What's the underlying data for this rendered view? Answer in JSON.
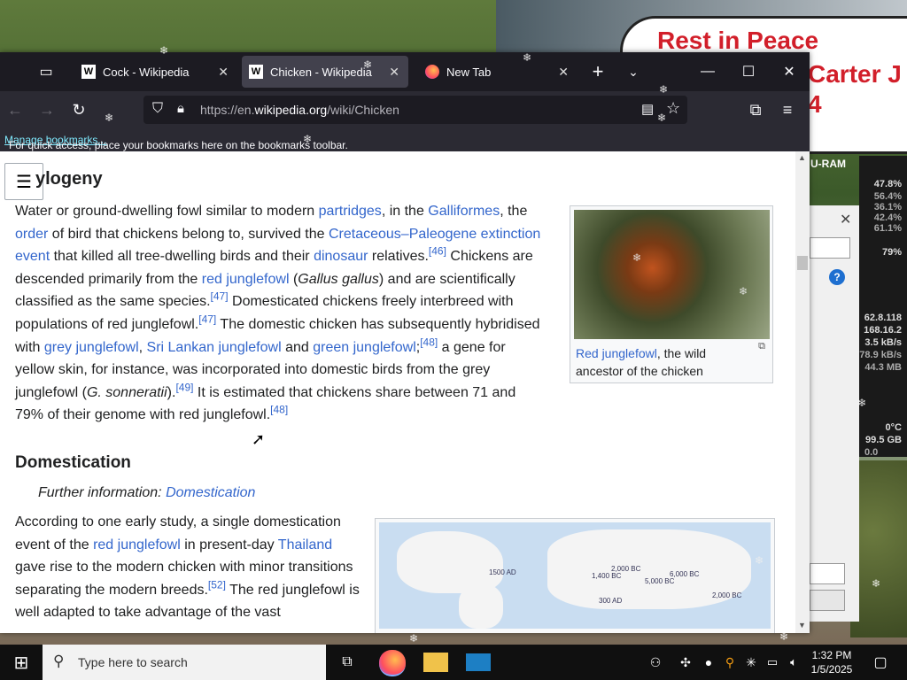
{
  "desktop": {
    "banner_line1": "Rest in Peace",
    "banner_line2": "Carter J",
    "banner_line3": "4"
  },
  "browser": {
    "tabs": [
      {
        "label": "Cock - Wikipedia",
        "icon": "wikipedia-icon"
      },
      {
        "label": "Chicken - Wikipedia",
        "icon": "wikipedia-icon"
      },
      {
        "label": "New Tab",
        "icon": "firefox-icon"
      }
    ],
    "url": "https://en.wikipedia.org/wiki/Chicken",
    "url_domain": "wikipedia.org",
    "url_prefix": "https://en.",
    "url_suffix": "/wiki/Chicken",
    "bookmarks_msg": "For quick access, place your bookmarks here on the bookmarks toolbar.",
    "bookmarks_link": "Manage bookmarks..."
  },
  "article": {
    "section1_title": "ylogeny",
    "section2_title": "Domestication",
    "further_info_label": "Further information:",
    "further_info_link": "Domestication",
    "p1": {
      "t1": "Water or ground-dwelling fowl similar to modern ",
      "l1": "partridges",
      "t2": ", in the ",
      "l2": "Galliformes",
      "t3": ", the ",
      "l3": "order",
      "t4": " of bird that chickens belong to, survived the ",
      "l4": "Cretaceous–Paleogene extinction event",
      "t5": " that killed all tree-dwelling birds and their ",
      "l5": "dinosaur",
      "t6": " relatives.",
      "r1": "[46]",
      "t7": " Chickens are descended primarily from the ",
      "l6": "red junglefowl",
      "t8": " (",
      "i1": "Gallus gallus",
      "t9": ") and are scientifically classified as the same species.",
      "r2": "[47]",
      "t10": " Domesticated chickens freely interbreed with populations of red junglefowl.",
      "r3": "[47]",
      "t11": " The domestic chicken has subsequently hybridised with ",
      "l7": "grey junglefowl",
      "t12": ", ",
      "l8": "Sri Lankan junglefowl",
      "t13": " and ",
      "l9": "green junglefowl",
      "t14": ";",
      "r4": "[48]",
      "t15": " a gene for yellow skin, for instance, was incorporated into domestic birds from the grey junglefowl (",
      "i2": "G. sonneratii",
      "t16": ").",
      "r5": "[49]",
      "t17": " It is estimated that chickens share between 71 and 79% of their genome with red junglefowl.",
      "r6": "[48]"
    },
    "figure1": {
      "caption_link": "Red junglefowl",
      "caption_text": ", the wild ancestor of the chicken"
    },
    "p2": {
      "t1": "According to one early study, a single domestication event of the ",
      "l1": "red junglefowl",
      "t2": " in present-day ",
      "l2": "Thailand",
      "t3": " gave rise to the modern chicken with minor transitions separating the modern breeds.",
      "r1": "[52]",
      "t4": " The red junglefowl is well adapted to take advantage of the vast"
    },
    "map_labels": [
      "1500 AD",
      "2,000 BC",
      "1,400 BC",
      "5,000 BC",
      "6,000 BC",
      "300 AD",
      "2,000 BC"
    ]
  },
  "gadget": {
    "title": "U-RAM",
    "values": [
      "47.8%",
      "56.4%",
      "36.1%",
      "42.4%",
      "61.1%",
      "79%",
      "62.8.118",
      "168.16.2",
      "3.5 kB/s",
      "78.9 kB/s",
      "44.3 MB",
      "0°C",
      "99.5 GB",
      "0.0"
    ],
    "temp": "0°C"
  },
  "taskbar": {
    "search_placeholder": "Type here to search",
    "time": "1:32 PM",
    "date": "1/5/2025"
  }
}
